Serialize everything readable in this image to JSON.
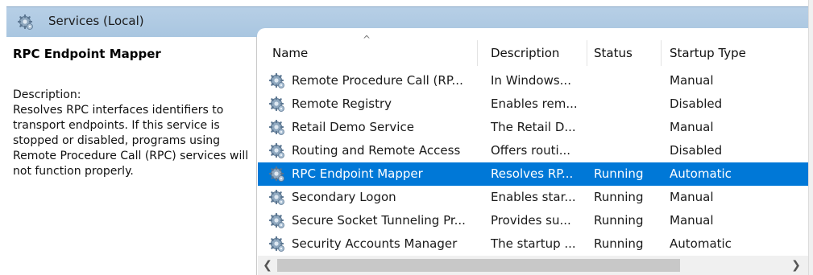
{
  "header": {
    "title": "Services (Local)",
    "icon": "services-gear-icon"
  },
  "detail": {
    "service_name": "RPC Endpoint Mapper",
    "description_label": "Description:",
    "description_text": "Resolves RPC interfaces identifiers to transport endpoints. If this service is stopped or disabled, programs using Remote Procedure Call (RPC) services will not function properly."
  },
  "columns": {
    "name": "Name",
    "description": "Description",
    "status": "Status",
    "startup_type": "Startup Type"
  },
  "rows": [
    {
      "name": "Remote Procedure Call (RP...",
      "description": "In Windows...",
      "status": "",
      "startup": "Manual",
      "selected": false
    },
    {
      "name": "Remote Registry",
      "description": "Enables rem...",
      "status": "",
      "startup": "Disabled",
      "selected": false
    },
    {
      "name": "Retail Demo Service",
      "description": "The Retail D...",
      "status": "",
      "startup": "Manual",
      "selected": false
    },
    {
      "name": "Routing and Remote Access",
      "description": "Offers routi...",
      "status": "",
      "startup": "Disabled",
      "selected": false
    },
    {
      "name": "RPC Endpoint Mapper",
      "description": "Resolves RP...",
      "status": "Running",
      "startup": "Automatic",
      "selected": true
    },
    {
      "name": "Secondary Logon",
      "description": "Enables star...",
      "status": "Running",
      "startup": "Manual",
      "selected": false
    },
    {
      "name": "Secure Socket Tunneling Pr...",
      "description": "Provides su...",
      "status": "Running",
      "startup": "Manual",
      "selected": false
    },
    {
      "name": "Security Accounts Manager",
      "description": "The startup ...",
      "status": "Running",
      "startup": "Automatic",
      "selected": false
    }
  ],
  "colors": {
    "header_bg": "#a9c6e0",
    "selection": "#0078d7"
  }
}
